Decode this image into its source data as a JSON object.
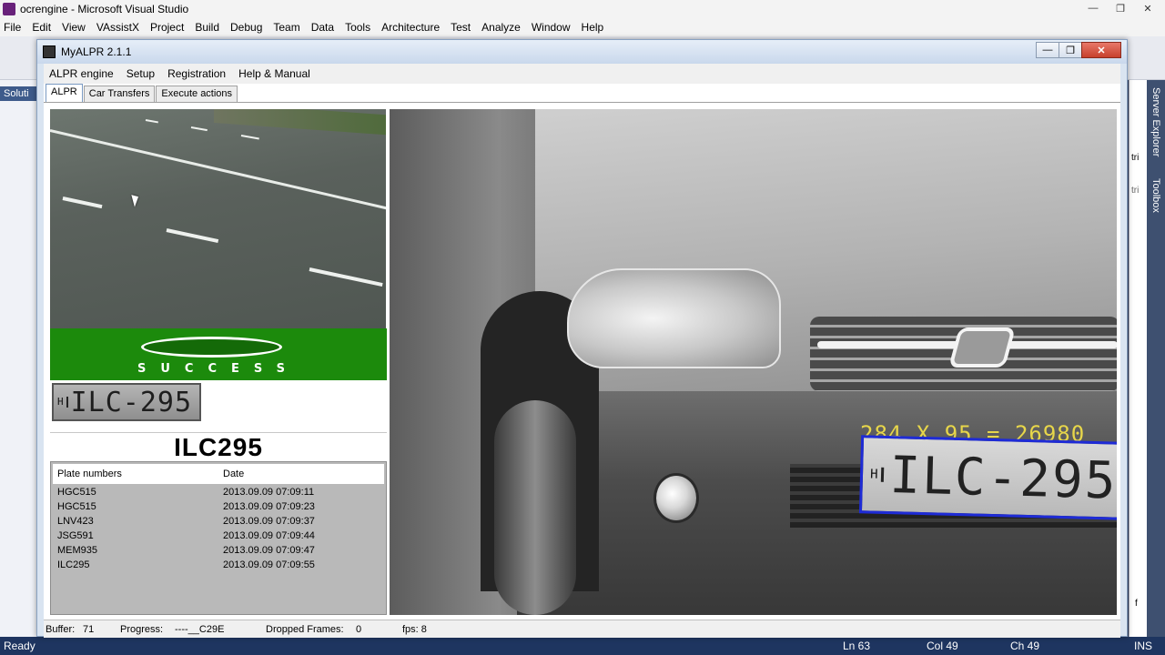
{
  "vs": {
    "title": "ocrengine - Microsoft Visual Studio",
    "menu": [
      "File",
      "Edit",
      "View",
      "VAssistX",
      "Project",
      "Build",
      "Debug",
      "Team",
      "Data",
      "Tools",
      "Architecture",
      "Test",
      "Analyze",
      "Window",
      "Help"
    ],
    "left_tab": "Soluti",
    "right_tabs": [
      "Server Explorer",
      "Toolbox"
    ],
    "right_hints": [
      "tri",
      "tri",
      "f"
    ],
    "status": {
      "ready": "Ready",
      "ln": "Ln 63",
      "col": "Col 49",
      "ch": "Ch 49",
      "ins": "INS"
    },
    "win_controls": {
      "minimize": "—",
      "maximize": "❐",
      "close": "✕"
    }
  },
  "alpr": {
    "title": "MyALPR 2.1.1",
    "win_controls": {
      "minimize": "—",
      "maximize": "❐",
      "close": "✕"
    },
    "menu": [
      "ALPR engine",
      "Setup",
      "Registration",
      "Help & Manual"
    ],
    "tabs": [
      "ALPR",
      "Car Transfers",
      "Execute actions"
    ],
    "active_tab": "ALPR",
    "success_text": "SUCCESS",
    "plate_crop": {
      "h": "H",
      "text": "ILC-295"
    },
    "plate_result": "ILC295",
    "table": {
      "headers": [
        "Plate numbers",
        "Date"
      ],
      "rows": [
        {
          "plate": "HGC515",
          "date": "2013.09.09 07:09:11"
        },
        {
          "plate": "HGC515",
          "date": "2013.09.09 07:09:23"
        },
        {
          "plate": "LNV423",
          "date": "2013.09.09 07:09:37"
        },
        {
          "plate": "JSG591",
          "date": "2013.09.09 07:09:44"
        },
        {
          "plate": "MEM935",
          "date": "2013.09.09 07:09:47"
        },
        {
          "plate": "ILC295",
          "date": "2013.09.09 07:09:55"
        }
      ]
    },
    "camera": {
      "dims_text": "284 X 95 = 26980",
      "plate_h": "H",
      "plate_text": "ILC-295"
    },
    "status": {
      "buffer_label": "Buffer:",
      "buffer_value": "71",
      "progress_label": "Progress:",
      "progress_value": "----__C29E",
      "dropped_label": "Dropped Frames:",
      "dropped_value": "0",
      "fps": "fps: 8"
    }
  },
  "colors": {
    "success_green": "#1c8a0c",
    "plate_box_blue": "#1e2bd6",
    "overlay_yellow": "#e7d64a",
    "vs_status_blue": "#1e3560"
  }
}
